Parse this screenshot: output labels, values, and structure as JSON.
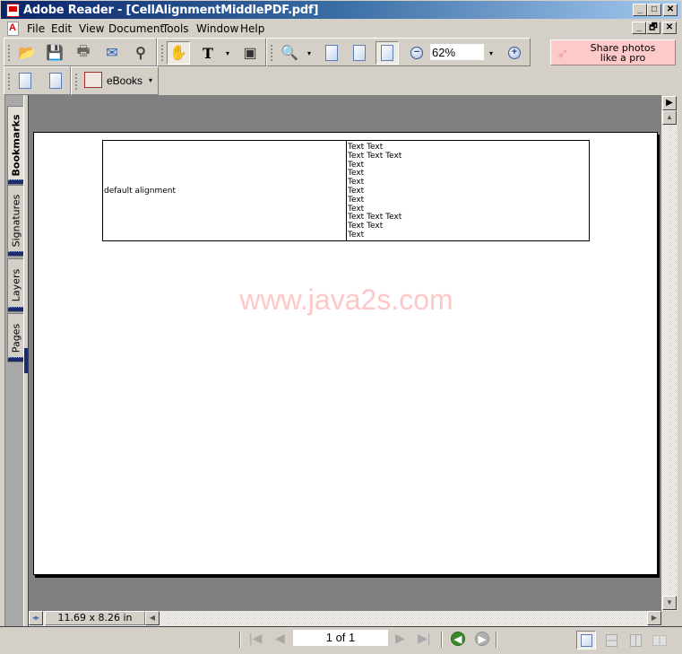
{
  "window": {
    "title": "Adobe Reader - [CellAlignmentMiddlePDF.pdf]",
    "buttons": {
      "minimize": "_",
      "maximize": "□",
      "close": "✕",
      "restore": "🗗"
    }
  },
  "menu": {
    "items": [
      "File",
      "Edit",
      "View",
      "Document",
      "Tools",
      "Window",
      "Help"
    ]
  },
  "toolbar": {
    "open_icon": "📂",
    "save_icon": "💾",
    "print_icon": "🖶",
    "email_icon": "✉",
    "search_icon": "⚲",
    "hand_icon": "✋",
    "select_text_icon": "T",
    "snapshot_icon": "▣",
    "zoom_in_tool_icon": "🔍",
    "zoom_value": "62%",
    "zoom_out_icon": "−",
    "zoom_in_icon": "+",
    "dropdown_icon": "▾",
    "ebooks_label": "eBooks",
    "share_label_line1": "Share photos",
    "share_label_line2": "like a pro"
  },
  "side_tabs": [
    "Bookmarks",
    "Signatures",
    "Layers",
    "Pages"
  ],
  "document": {
    "left_cell": "default alignment",
    "right_cell_lines": [
      "Text Text",
      "Text Text Text",
      "Text",
      "Text",
      "Text",
      "Text",
      "Text",
      "Text",
      "Text Text Text",
      "Text Text",
      "Text"
    ],
    "watermark": "www.java2s.com"
  },
  "scrollbar": {
    "page_size": "11.69 x 8.26 in",
    "up": "▲",
    "down": "▼",
    "left": "◀",
    "right": "▶"
  },
  "navigation": {
    "page_display": "1 of 1",
    "first": "|◀",
    "prev": "◀",
    "next": "▶",
    "last": "▶|",
    "go_back": "◀",
    "go_forward": "▶"
  }
}
